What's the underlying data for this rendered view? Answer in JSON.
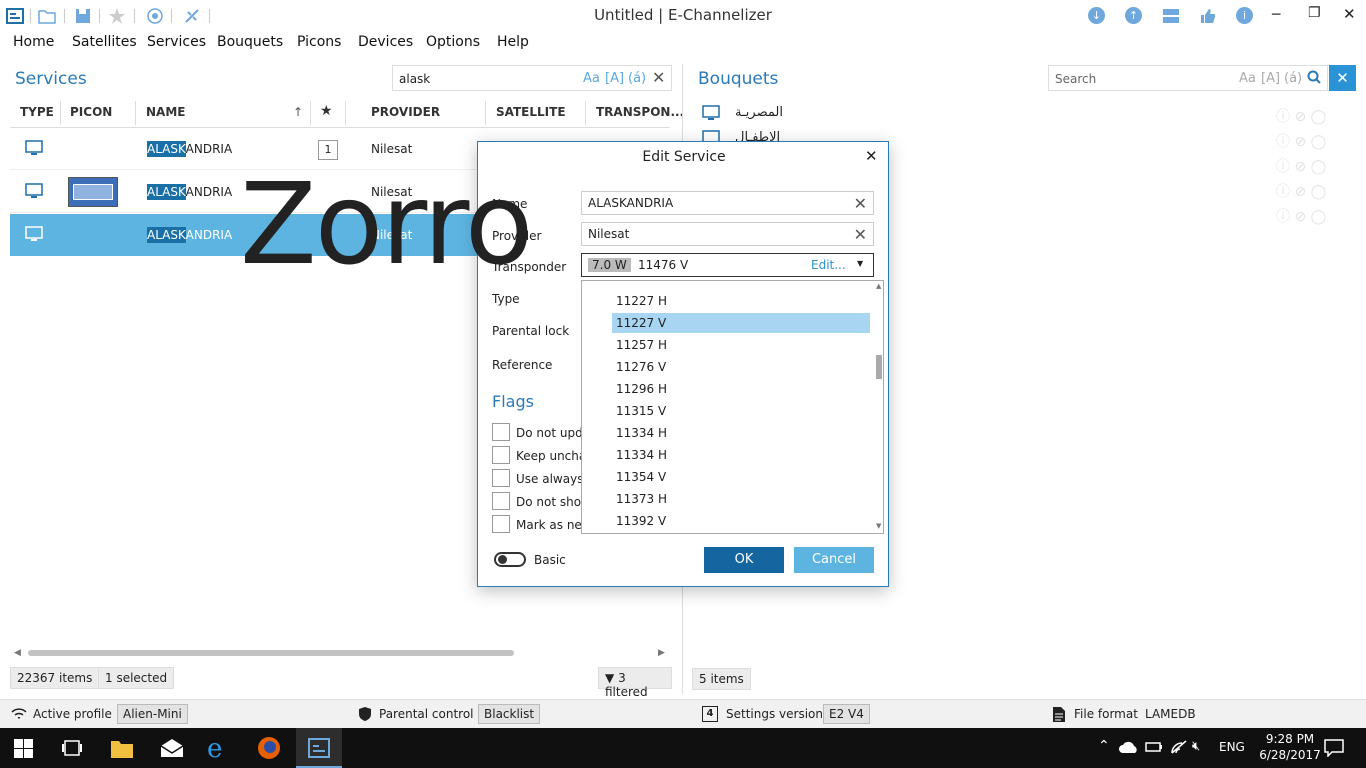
{
  "app": {
    "title": "Untitled | E-Channelizer"
  },
  "menu": [
    "Home",
    "Satellites",
    "Services",
    "Bouquets",
    "Picons",
    "Devices",
    "Options",
    "Help"
  ],
  "services": {
    "title": "Services",
    "search_value": "alask",
    "search_options": [
      "Aa",
      "[A]",
      "(á)"
    ],
    "columns": [
      "TYPE",
      "PICON",
      "NAME",
      "★",
      "PROVIDER",
      "SATELLITE",
      "TRANSPON..."
    ],
    "rows": [
      {
        "name_hl": "ALASK",
        "name_rest": "ANDRIA",
        "fav": "1",
        "provider": "Nilesat"
      },
      {
        "name_hl": "ALASK",
        "name_rest": "ANDRIA",
        "fav": "",
        "provider": "Nilesat"
      },
      {
        "name_hl": "ALASK",
        "name_rest": "ANDRIA",
        "fav": "",
        "provider": "Nilesat"
      }
    ],
    "status": {
      "items": "22367 items",
      "selected": "1 selected",
      "filtered": "3 filtered"
    }
  },
  "bouquets": {
    "title": "Bouquets",
    "search_placeholder": "Search",
    "search_options": [
      "Aa",
      "[A]",
      "(á)"
    ],
    "items": [
      "المصريـة",
      "الاطفـال"
    ],
    "status": {
      "items": "5 items"
    }
  },
  "dialog": {
    "title": "Edit Service",
    "labels": {
      "name": "Name",
      "provider": "Provider",
      "transponder": "Transponder",
      "type": "Type",
      "parental": "Parental lock",
      "reference": "Reference"
    },
    "name_value": "ALASKANDRIA",
    "provider_value": "Nilesat",
    "transponder": {
      "satellite": "7.0 W",
      "value": "11476 V",
      "edit": "Edit..."
    },
    "dropdown": [
      "11227 H",
      "11227 V",
      "11257 H",
      "11276 V",
      "11296 H",
      "11315 V",
      "11334 H",
      "11334 H",
      "11354 V",
      "11373 H",
      "11392 V"
    ],
    "dropdown_selected_index": 1,
    "flags_title": "Flags",
    "flags": [
      "Do not upda",
      "Keep unchar",
      "Use always t",
      "Do not show",
      "Mark as new"
    ],
    "toggle_label": "Basic",
    "ok": "OK",
    "cancel": "Cancel"
  },
  "watermark": "Zorro",
  "bottombar": {
    "active_profile_label": "Active profile",
    "active_profile_value": "Alien-Mini",
    "parental_label": "Parental control",
    "parental_value": "Blacklist",
    "settings_label": "Settings version",
    "settings_value": "E2 V4",
    "fileformat_label": "File format",
    "fileformat_value": "LAMEDB"
  },
  "taskbar": {
    "lang": "ENG",
    "time": "9:28 PM",
    "date": "6/28/2017"
  },
  "colors": {
    "accent": "#2a7ab8",
    "selected_row": "#5db4e0",
    "dropdown_selected": "#a8d5f2",
    "ok": "#1565a0",
    "cancel": "#5db4e0"
  }
}
